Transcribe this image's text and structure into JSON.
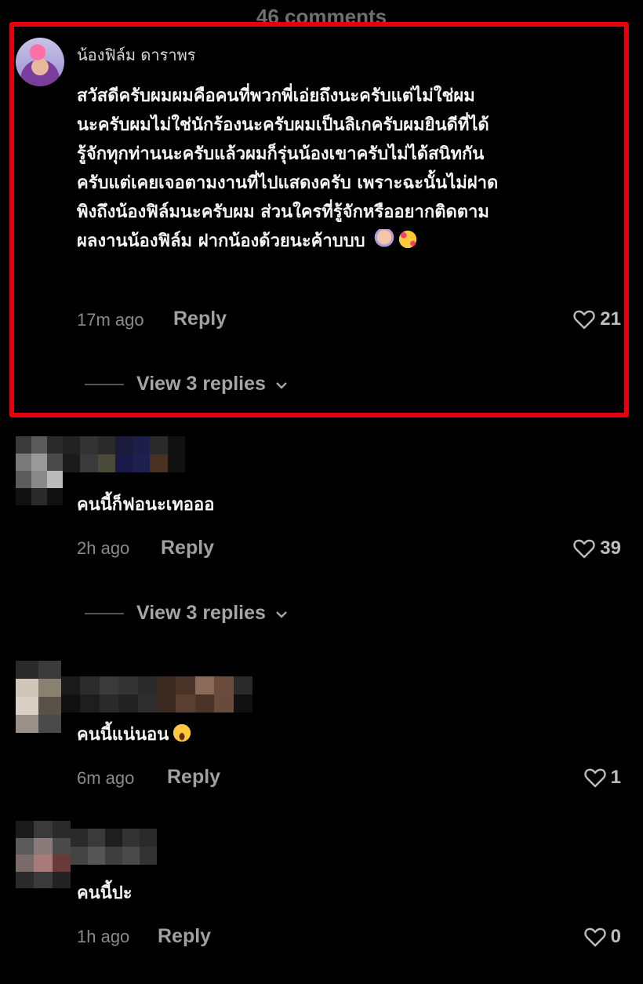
{
  "header": {
    "title": "46 comments"
  },
  "comments": [
    {
      "username": "น้องฟิล์ม ดาราพร",
      "lines": [
        "สวัสดีครับผมผมคือคนที่พวกพี่เอ่ยถึงนะครับแต่ไม่ใช่ผม",
        "นะครับผมไม่ใช่นักร้องนะครับผมเป็นลิเกครับผมยินดีที่ได้",
        "รู้จักทุกท่านนะครับแล้วผมก็รุ่นน้องเขาครับไม่ได้สนิทกัน",
        "ครับแต่เคยเจอตามงานที่ไปแสดงครับ เพราะฉะนั้นไม่ฝาด",
        "พิงถึงน้องฟิล์มนะครับผม ส่วนใครที่รู้จักหรืออยากติดตาม",
        "ผลงานน้องฟิล์ม ฝากน้องด้วยนะค้าบบบ"
      ],
      "emojis": [
        "folded-hands-emoji",
        "smiling-face-with-hearts-emoji"
      ],
      "time": "17m ago",
      "reply_label": "Reply",
      "likes": "21",
      "view_replies": "View 3 replies",
      "highlighted": true
    },
    {
      "username": "",
      "text": "คนนี้ก็ฟอนะเทอออ",
      "time": "2h ago",
      "reply_label": "Reply",
      "likes": "39",
      "view_replies": "View 3 replies"
    },
    {
      "username": "",
      "text": "คนนี้แน่นอน",
      "emojis": [
        "grinning-squinting-face-emoji"
      ],
      "time": "6m ago",
      "reply_label": "Reply",
      "likes": "1"
    },
    {
      "username": "",
      "text": "คนนี้ปะ",
      "time": "1h ago",
      "reply_label": "Reply",
      "likes": "0"
    }
  ],
  "colors": {
    "highlight_border": "#e3000f",
    "background": "#000000"
  }
}
